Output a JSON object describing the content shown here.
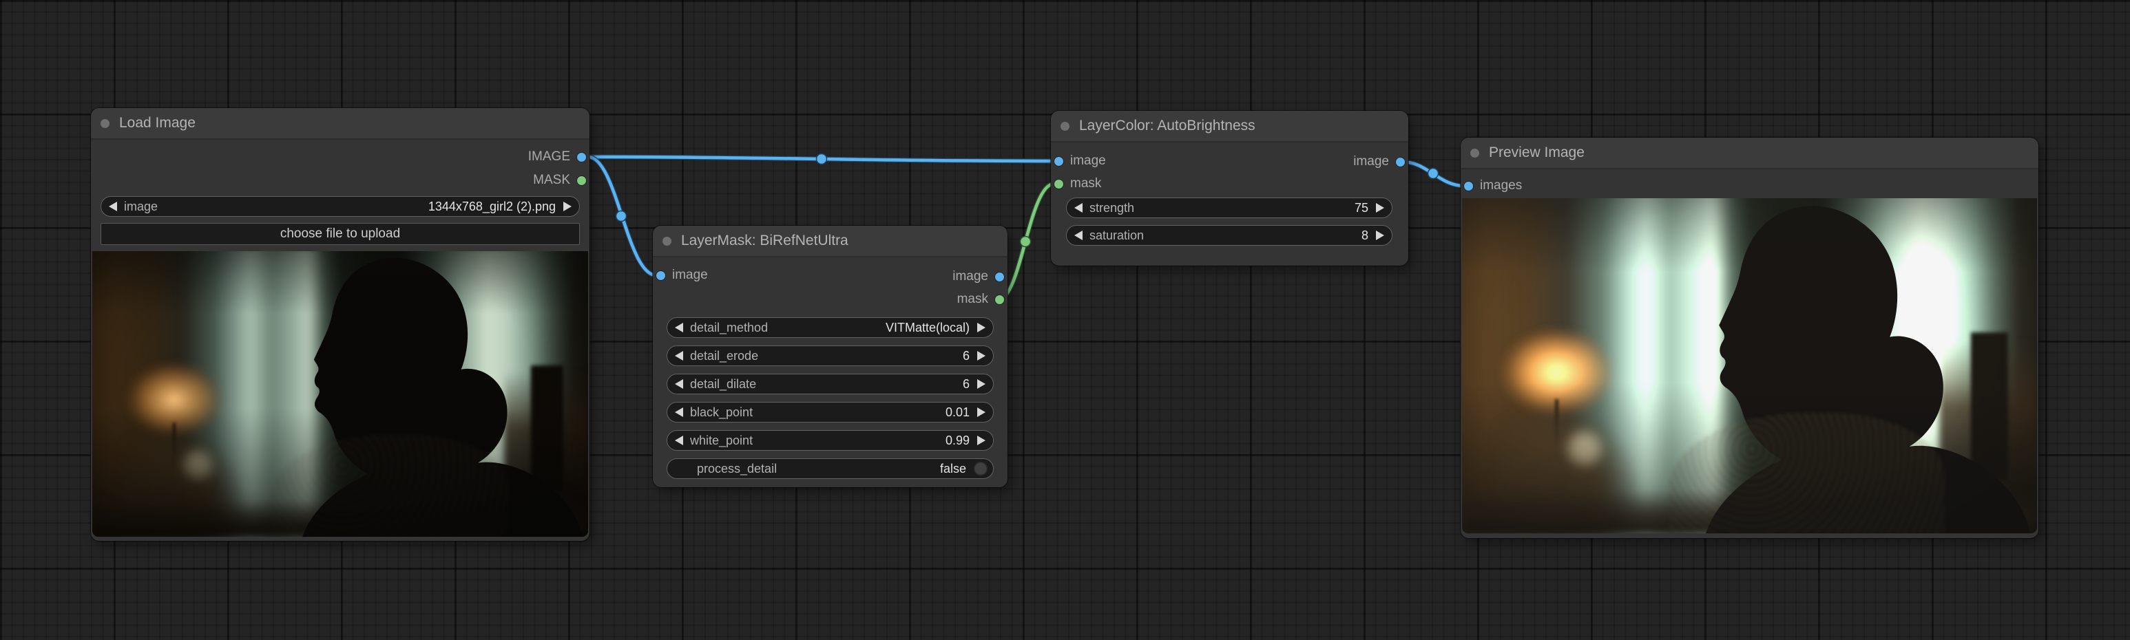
{
  "graph": {
    "nodes": [
      {
        "title": "Load Image",
        "outputs": [
          {
            "name": "IMAGE",
            "type": "IMAGE"
          },
          {
            "name": "MASK",
            "type": "MASK"
          }
        ],
        "widgets": [
          {
            "kind": "combo",
            "label": "image",
            "value": "1344x768_girl2 (2).png"
          },
          {
            "kind": "button",
            "label": "choose file to upload"
          }
        ]
      },
      {
        "title": "LayerMask: BiRefNetUltra",
        "inputs": [
          {
            "name": "image",
            "type": "IMAGE"
          }
        ],
        "outputs": [
          {
            "name": "image",
            "type": "IMAGE"
          },
          {
            "name": "mask",
            "type": "MASK"
          }
        ],
        "widgets": [
          {
            "kind": "combo",
            "label": "detail_method",
            "value": "VITMatte(local)"
          },
          {
            "kind": "number",
            "label": "detail_erode",
            "value": "6"
          },
          {
            "kind": "number",
            "label": "detail_dilate",
            "value": "6"
          },
          {
            "kind": "number",
            "label": "black_point",
            "value": "0.01"
          },
          {
            "kind": "number",
            "label": "white_point",
            "value": "0.99"
          },
          {
            "kind": "toggle",
            "label": "process_detail",
            "value": "false"
          }
        ]
      },
      {
        "title": "LayerColor: AutoBrightness",
        "inputs": [
          {
            "name": "image",
            "type": "IMAGE"
          },
          {
            "name": "mask",
            "type": "MASK"
          }
        ],
        "outputs": [
          {
            "name": "image",
            "type": "IMAGE"
          }
        ],
        "widgets": [
          {
            "kind": "number",
            "label": "strength",
            "value": "75"
          },
          {
            "kind": "number",
            "label": "saturation",
            "value": "8"
          }
        ]
      },
      {
        "title": "Preview Image",
        "inputs": [
          {
            "name": "images",
            "type": "IMAGE"
          }
        ]
      }
    ],
    "links": [
      {
        "from": "Load Image.IMAGE",
        "to": "LayerMask: BiRefNetUltra.image",
        "type": "IMAGE"
      },
      {
        "from": "Load Image.IMAGE",
        "to": "LayerColor: AutoBrightness.image",
        "type": "IMAGE"
      },
      {
        "from": "LayerMask: BiRefNetUltra.mask",
        "to": "LayerColor: AutoBrightness.mask",
        "type": "MASK"
      },
      {
        "from": "LayerColor: AutoBrightness.image",
        "to": "Preview Image.images",
        "type": "IMAGE"
      }
    ]
  },
  "colors": {
    "image_link": "#5db2f0",
    "mask_link": "#7fca7f",
    "canvas_bg": "#242424",
    "node_bg": "#343434",
    "node_title_bg": "#3b3b3b",
    "widget_bg": "#1b1b1b"
  }
}
